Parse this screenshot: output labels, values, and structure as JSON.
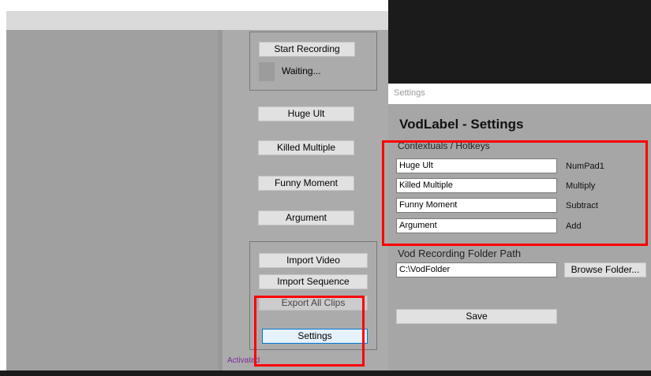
{
  "main": {
    "start_recording": "Start Recording",
    "status": "Waiting...",
    "labels": [
      "Huge Ult",
      "Killed Multiple",
      "Funny Moment",
      "Argument"
    ],
    "import_video": "Import Video",
    "import_sequence": "Import Sequence",
    "export_all_clips": "Export All Clips",
    "settings": "Settings",
    "activated": "Activated"
  },
  "settings": {
    "window_title": "Settings",
    "heading": "VodLabel - Settings",
    "contextuals_label": "Contextuals / Hotkeys",
    "rows": [
      {
        "value": "Huge Ult",
        "hotkey": "NumPad1"
      },
      {
        "value": "Killed Multiple",
        "hotkey": "Multiply"
      },
      {
        "value": "Funny Moment",
        "hotkey": "Subtract"
      },
      {
        "value": "Argument",
        "hotkey": "Add"
      }
    ],
    "folder_label": "Vod Recording Folder Path",
    "folder_value": "C:\\VodFolder",
    "browse": "Browse Folder...",
    "save": "Save"
  },
  "colors": {
    "highlight": "#ff0000",
    "activated": "#7a2e9b",
    "focus": "#0078d7"
  }
}
